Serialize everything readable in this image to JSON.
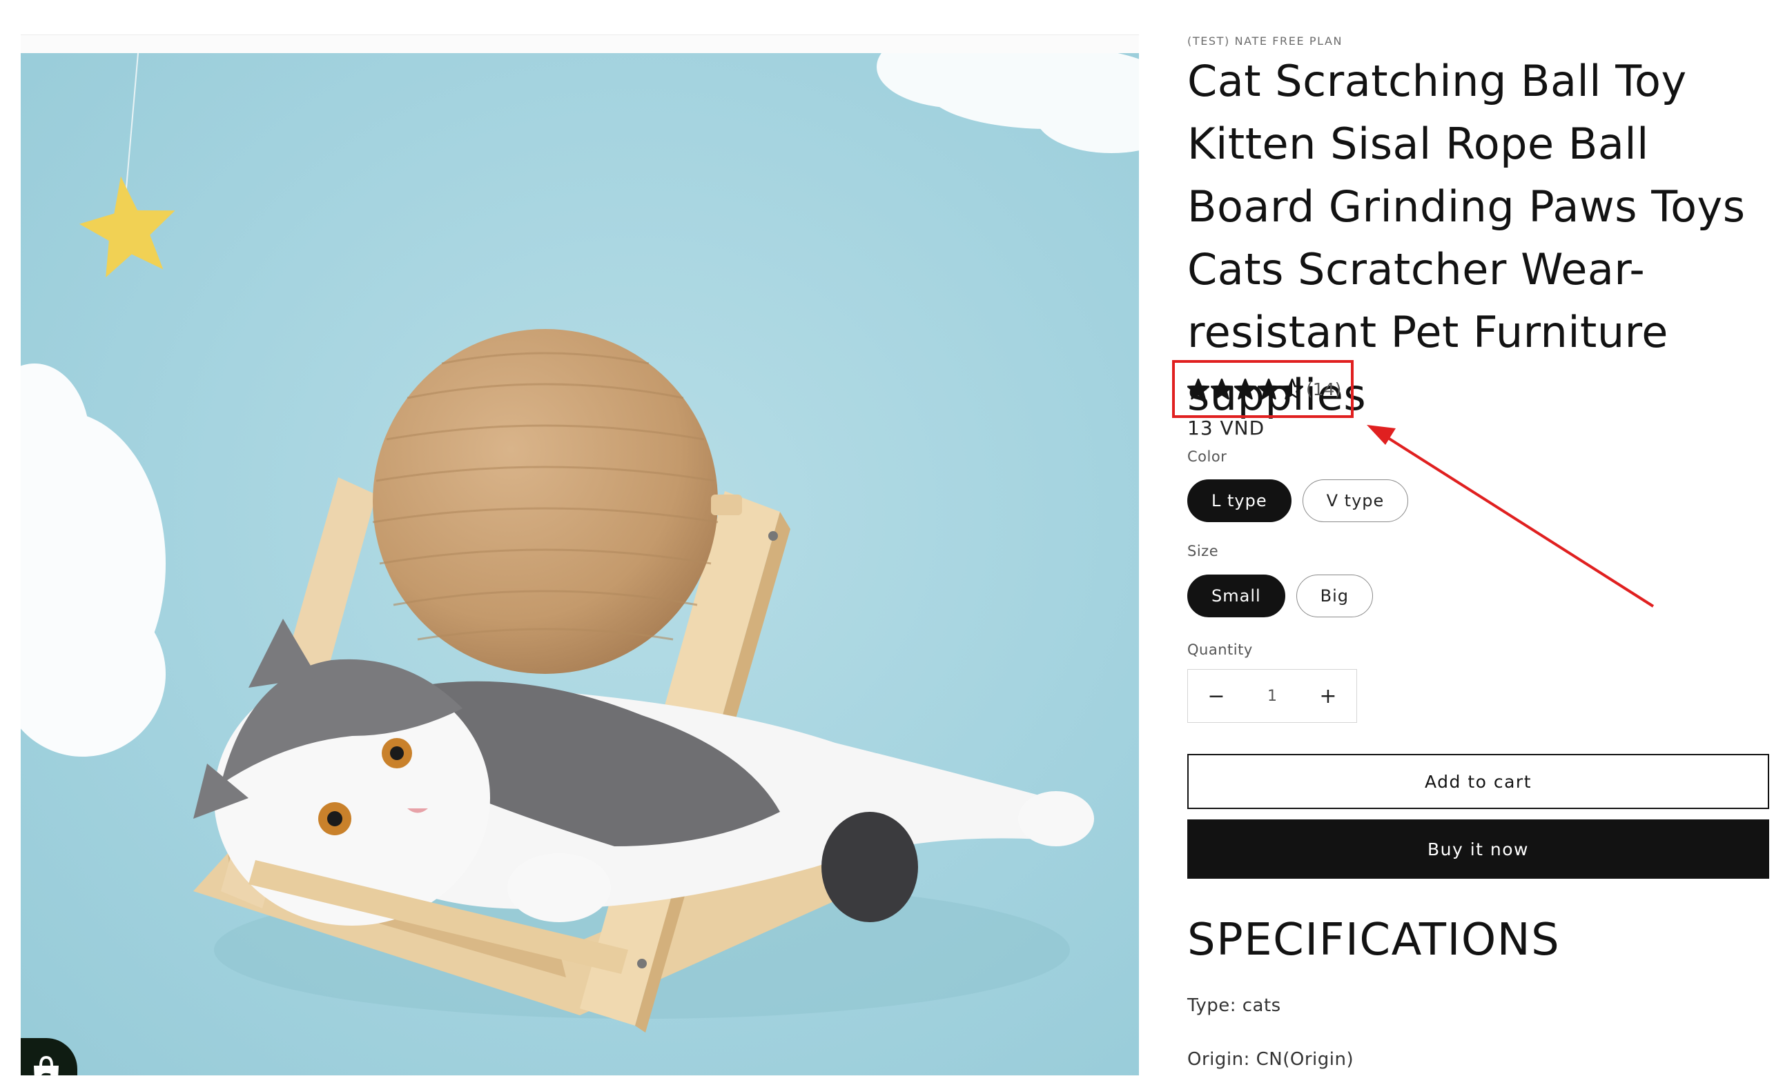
{
  "product": {
    "vendor": "(TEST) NATE FREE PLAN",
    "title": "Cat Scratching Ball Toy Kitten Sisal Rope Ball Board Grinding Paws Toys Cats Scratcher Wear-resistant Pet Furniture supplies",
    "rating": {
      "stars": 4.5,
      "out_of": 5,
      "count_text": "(14)"
    },
    "price": "13 VND",
    "color": {
      "label": "Color",
      "options": [
        "L type",
        "V type"
      ],
      "selected": "L type"
    },
    "size": {
      "label": "Size",
      "options": [
        "Small",
        "Big"
      ],
      "selected": "Small"
    },
    "quantity": {
      "label": "Quantity",
      "value": "1",
      "decrement": "−",
      "increment": "+"
    },
    "add_to_cart": "Add to cart",
    "buy_now": "Buy it now",
    "specifications": {
      "heading": "SPECIFICATIONS",
      "lines": [
        "Type: cats",
        "Origin: CN(Origin)"
      ]
    }
  },
  "media": {
    "alt_icon": "product-photo-cat-scratching-ball",
    "badge_icon": "shopify-bag-icon"
  },
  "annotation": {
    "color": "#e02020"
  },
  "colors": {
    "primary": "#121212",
    "background": "#ffffff",
    "muted": "#6b6b6b"
  }
}
